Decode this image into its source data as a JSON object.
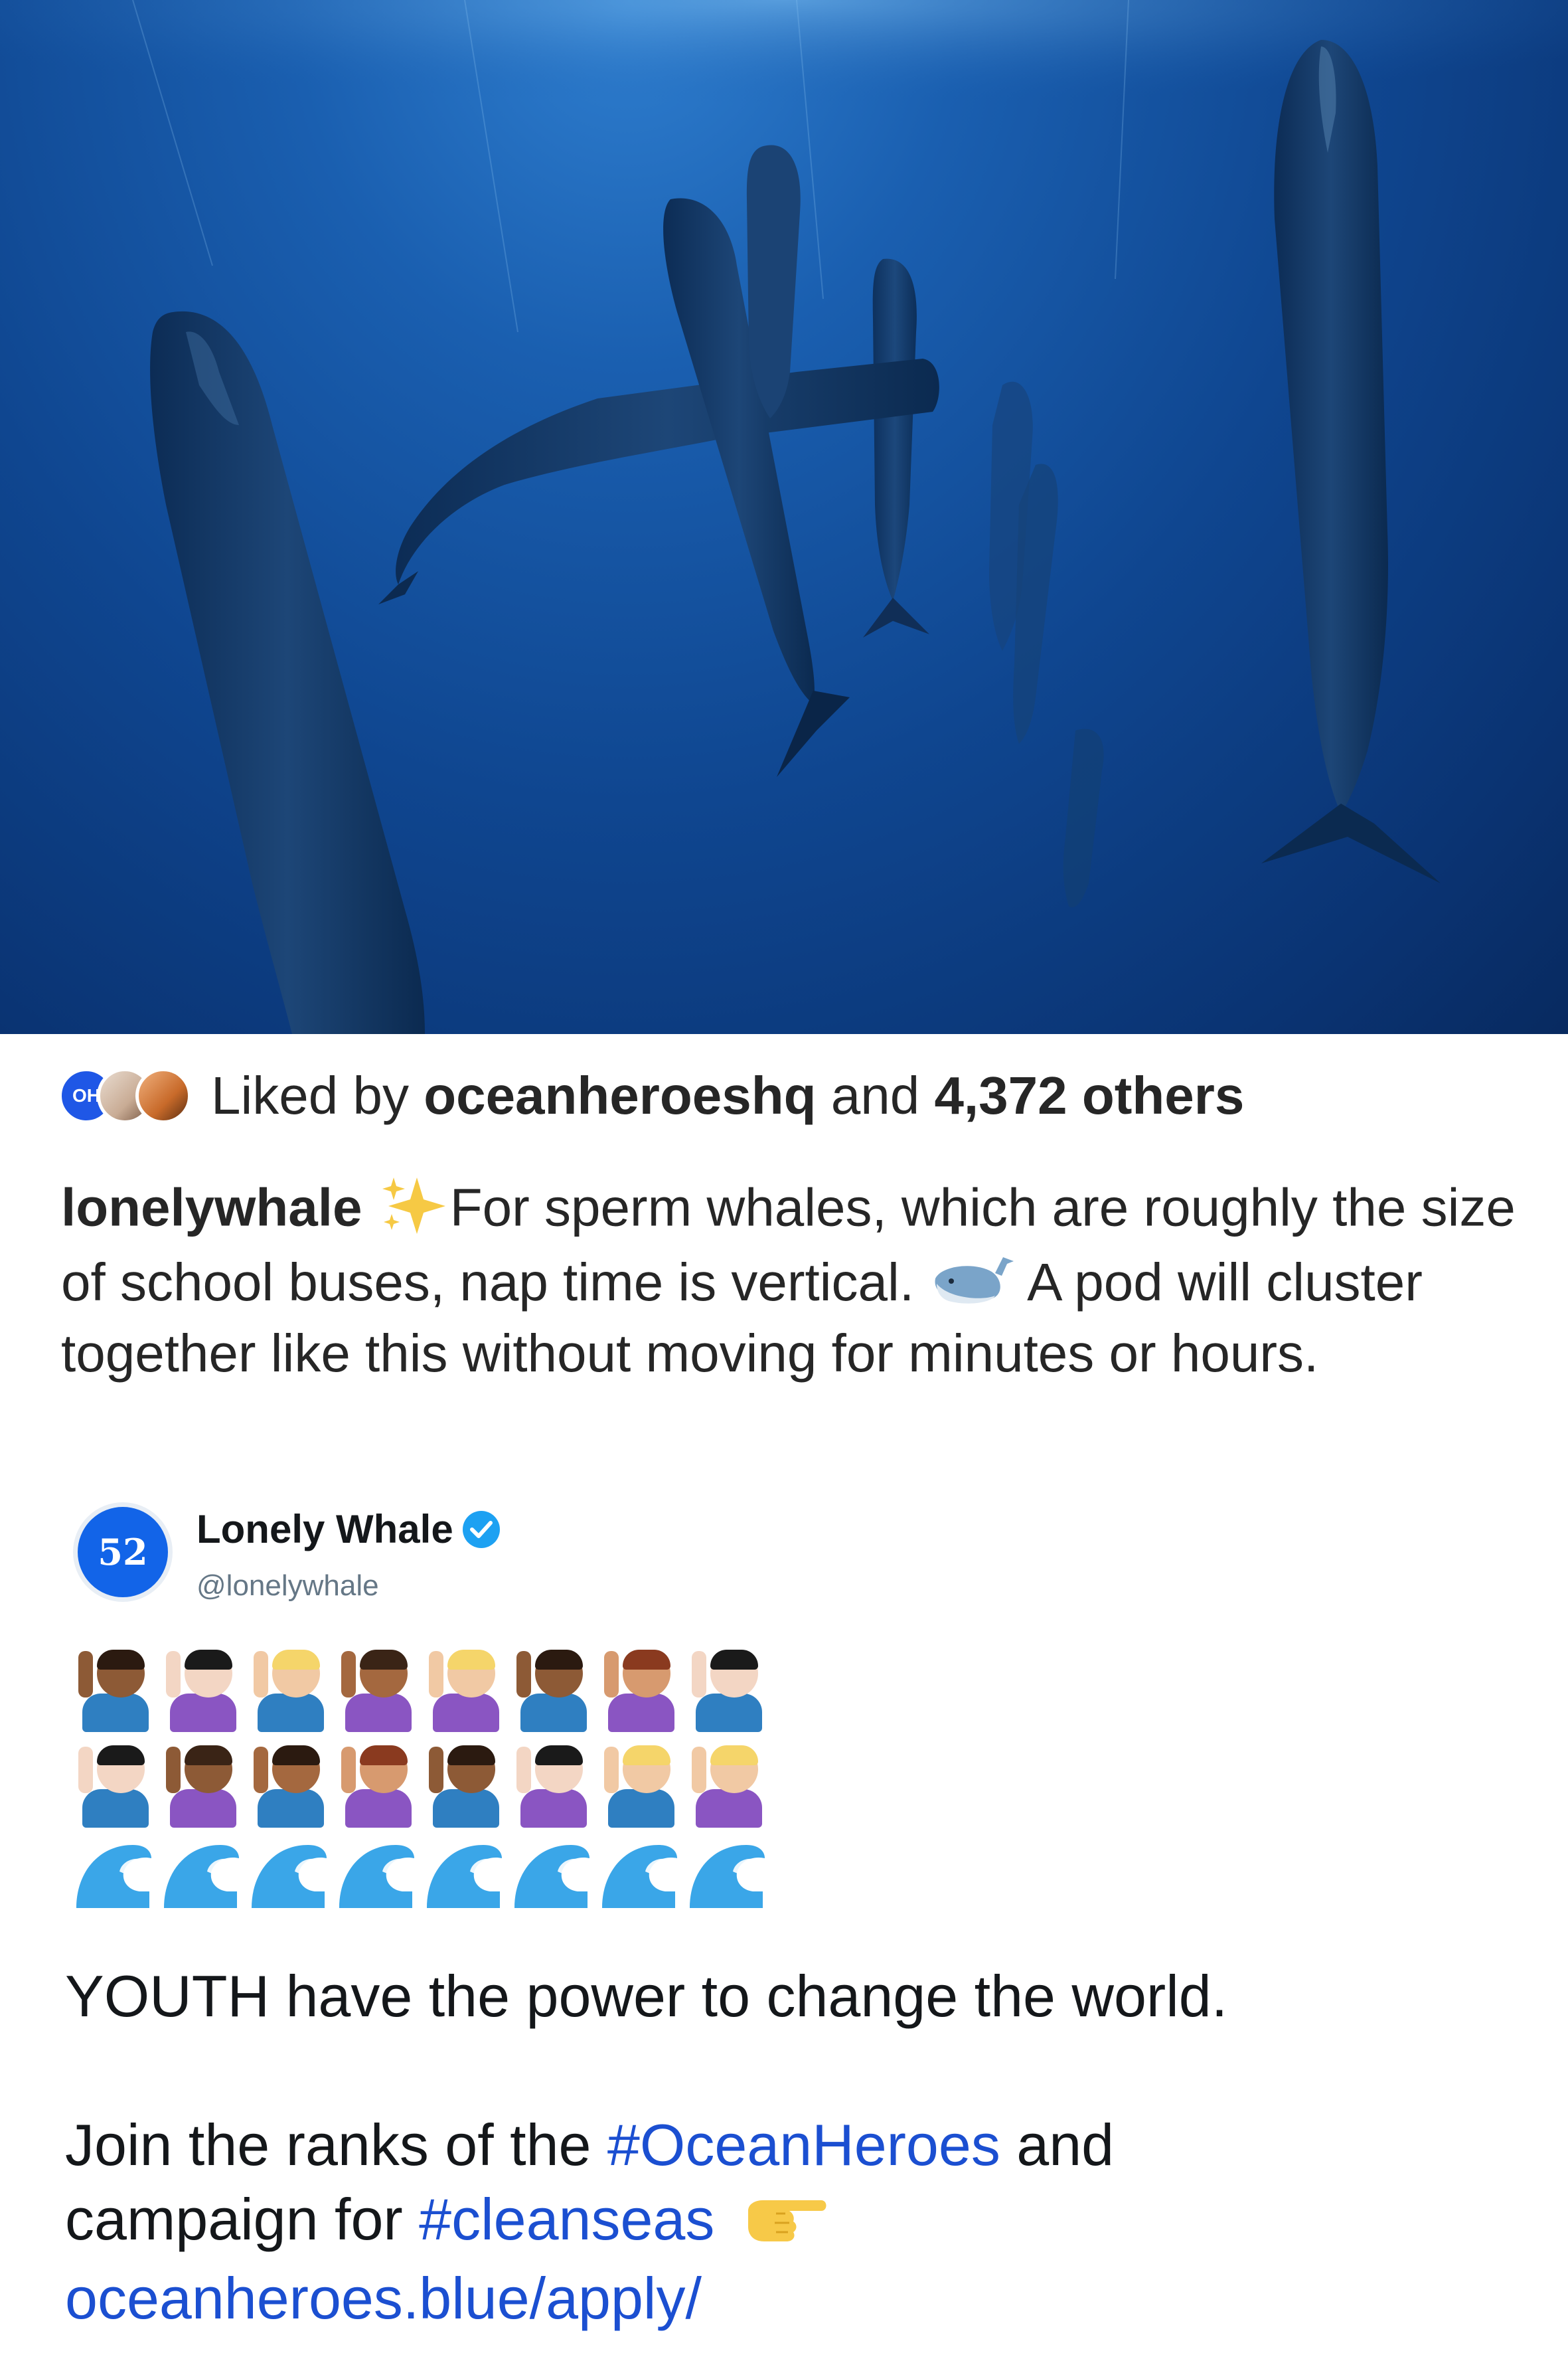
{
  "post": {
    "liked_prefix": "Liked by ",
    "liked_user": "oceanheroeshq",
    "liked_middle": " and ",
    "liked_count": "4,372 others",
    "avatar_initials": "OH",
    "caption_user": "lonelywhale",
    "caption_part1": "For sperm whales, which are roughly the size of school buses, nap time is vertical.",
    "caption_part2": "A pod will cluster together like this without moving for minutes or hours."
  },
  "tweet": {
    "display_name": "Lonely Whale",
    "handle": "@lonelywhale",
    "avatar_glyph": "52",
    "line1": "YOUTH have the power to change the world.",
    "line2_prefix": "Join the ranks of the ",
    "hashtag1": "#OceanHeroes",
    "line2_suffix": " and",
    "line3_prefix": "campaign for ",
    "hashtag2": "#cleanseas",
    "link": "oceanheroes.blue/apply/"
  },
  "colors": {
    "ocean_dark": "#082a60",
    "ocean_light": "#2f7fd0",
    "hashtag": "#1b4fd1",
    "verified": "#1da1f2",
    "tweet_avatar": "#1264e8"
  },
  "icons": {
    "sparkles": "sparkles-icon",
    "whale": "whale-icon",
    "verified": "verified-badge-icon",
    "pointing": "pointing-right-icon",
    "wave": "water-wave-icon",
    "person": "person-raising-hand-icon"
  }
}
